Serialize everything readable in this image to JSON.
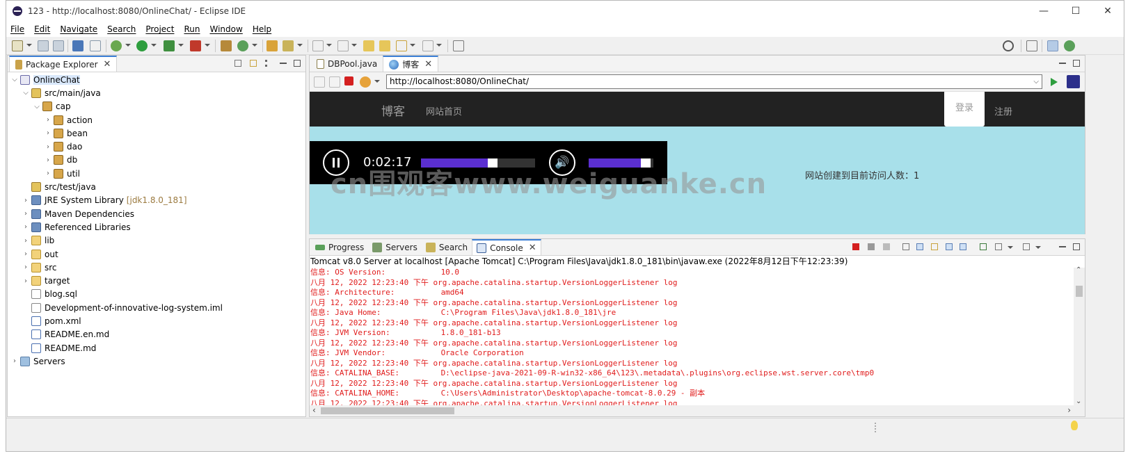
{
  "window": {
    "title": "123 - http://localhost:8080/OnlineChat/ - Eclipse IDE",
    "minimize": "—",
    "maximize": "☐",
    "close": "✕"
  },
  "menu": [
    "File",
    "Edit",
    "Navigate",
    "Search",
    "Project",
    "Run",
    "Window",
    "Help"
  ],
  "package_explorer": {
    "tab_label": "Package Explorer",
    "tree": [
      {
        "label": "OnlineChat",
        "twisty": "⌵",
        "icon": "project-icon"
      },
      {
        "label": "src/main/java",
        "twisty": "⌵",
        "icon": "source-folder-icon"
      },
      {
        "label": "cap",
        "twisty": "⌵",
        "icon": "package-icon"
      },
      {
        "label": "action",
        "twisty": "›",
        "icon": "package-icon"
      },
      {
        "label": "bean",
        "twisty": "›",
        "icon": "package-icon"
      },
      {
        "label": "dao",
        "twisty": "›",
        "icon": "package-icon"
      },
      {
        "label": "db",
        "twisty": "›",
        "icon": "package-icon"
      },
      {
        "label": "util",
        "twisty": "›",
        "icon": "package-icon"
      },
      {
        "label": "src/test/java",
        "twisty": "",
        "icon": "source-folder-icon"
      },
      {
        "label": "JRE System Library",
        "suffix": "[jdk1.8.0_181]",
        "twisty": "›",
        "icon": "library-icon"
      },
      {
        "label": "Maven Dependencies",
        "twisty": "›",
        "icon": "library-icon"
      },
      {
        "label": "Referenced Libraries",
        "twisty": "›",
        "icon": "library-icon"
      },
      {
        "label": "lib",
        "twisty": "›",
        "icon": "folder-icon"
      },
      {
        "label": "out",
        "twisty": "›",
        "icon": "folder-icon"
      },
      {
        "label": "src",
        "twisty": "›",
        "icon": "folder-icon"
      },
      {
        "label": "target",
        "twisty": "›",
        "icon": "folder-icon"
      },
      {
        "label": "blog.sql",
        "twisty": "",
        "icon": "file-icon"
      },
      {
        "label": "Development-of-innovative-log-system.iml",
        "twisty": "",
        "icon": "file-icon"
      },
      {
        "label": "pom.xml",
        "twisty": "",
        "icon": "xml-file-icon"
      },
      {
        "label": "README.en.md",
        "twisty": "",
        "icon": "md-file-icon"
      },
      {
        "label": "README.md",
        "twisty": "",
        "icon": "md-file-icon"
      },
      {
        "label": "Servers",
        "twisty": "›",
        "icon": "servers-folder-icon"
      }
    ]
  },
  "editor": {
    "tabs": [
      {
        "label": "DBPool.java",
        "active": false
      },
      {
        "label": "博客",
        "active": true
      }
    ],
    "tab_close": "✕",
    "url": "http://localhost:8080/OnlineChat/",
    "url_dropdown": "⌵"
  },
  "webpage": {
    "brand": "博客",
    "nav_home": "网站首页",
    "login": "登录",
    "register": "注册",
    "player": {
      "time": "0:02:17",
      "progress": 0.63,
      "volume": 0.88,
      "volume_glyph": "🔊"
    },
    "watermark": "cn围观客www.weiguanke.cn",
    "visit_text": "网站创建到目前访问人数：1"
  },
  "console": {
    "tabs": [
      "Progress",
      "Servers",
      "Search",
      "Console"
    ],
    "active_tab": "Console",
    "tab_close": "✕",
    "header": "Tomcat v8.0 Server at localhost [Apache Tomcat] C:\\Program Files\\Java\\jdk1.8.0_181\\bin\\javaw.exe  (2022年8月12日下午12:23:39)",
    "lines": [
      "信息: OS Version:            10.0",
      "八月 12, 2022 12:23:40 下午 org.apache.catalina.startup.VersionLoggerListener log",
      "信息: Architecture:          amd64",
      "八月 12, 2022 12:23:40 下午 org.apache.catalina.startup.VersionLoggerListener log",
      "信息: Java Home:             C:\\Program Files\\Java\\jdk1.8.0_181\\jre",
      "八月 12, 2022 12:23:40 下午 org.apache.catalina.startup.VersionLoggerListener log",
      "信息: JVM Version:           1.8.0_181-b13",
      "八月 12, 2022 12:23:40 下午 org.apache.catalina.startup.VersionLoggerListener log",
      "信息: JVM Vendor:            Oracle Corporation",
      "八月 12, 2022 12:23:40 下午 org.apache.catalina.startup.VersionLoggerListener log",
      "信息: CATALINA_BASE:         D:\\eclipse-java-2021-09-R-win32-x86_64\\123\\.metadata\\.plugins\\org.eclipse.wst.server.core\\tmp0",
      "八月 12, 2022 12:23:40 下午 org.apache.catalina.startup.VersionLoggerListener log",
      "信息: CATALINA_HOME:         C:\\Users\\Administrator\\Desktop\\apache-tomcat-8.0.29 - 副本",
      "八月 12, 2022 12:23:40 下午 org.apache.catalina.startup.VersionLoggerListener log"
    ]
  },
  "scroll_arrows": {
    "up": "⌃",
    "down": "⌄",
    "left": "‹",
    "right": "›"
  },
  "statusbar": {
    "tip_icon": "lightbulb-icon"
  },
  "colors": {
    "console_text": "#e01b1b",
    "player_fill": "#5b2fd1",
    "web_bg": "#a8e0ea",
    "navbar": "#222222",
    "accent": "#3c7fd6"
  }
}
